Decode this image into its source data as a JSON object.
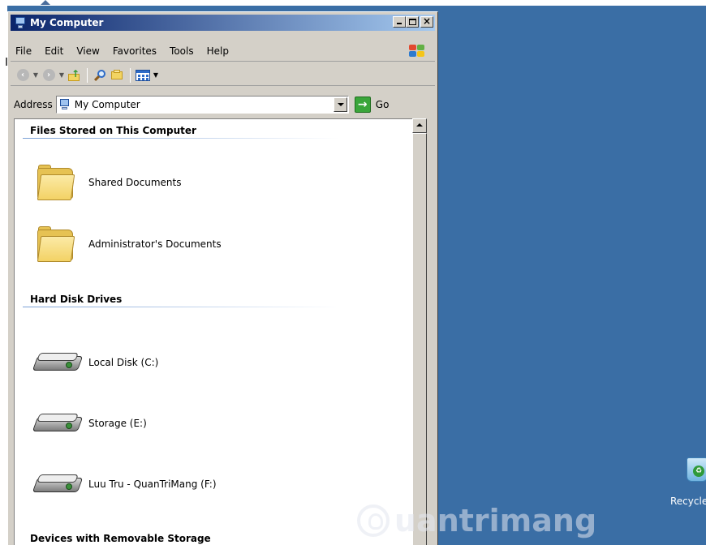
{
  "window": {
    "title": "My Computer",
    "buttons": {
      "minimize": "_",
      "maximize": "□",
      "close": "×"
    }
  },
  "menubar": {
    "items": [
      "File",
      "Edit",
      "View",
      "Favorites",
      "Tools",
      "Help"
    ]
  },
  "toolbar": {
    "icons": [
      "back-icon",
      "forward-icon",
      "up-folder-icon",
      "search-icon",
      "folders-icon",
      "views-icon"
    ]
  },
  "address": {
    "label": "Address",
    "value": "My Computer",
    "go_label": "Go"
  },
  "sections": [
    {
      "heading": "Files Stored on This Computer",
      "items": [
        {
          "label": "Shared Documents",
          "icon": "folder-icon"
        },
        {
          "label": "Administrator's Documents",
          "icon": "folder-icon"
        }
      ]
    },
    {
      "heading": "Hard Disk Drives",
      "items": [
        {
          "label": "Local Disk (C:)",
          "icon": "hard-drive-icon"
        },
        {
          "label": "Storage (E:)",
          "icon": "hard-drive-icon"
        },
        {
          "label": "Luu Tru - QuanTriMang (F:)",
          "icon": "hard-drive-icon"
        }
      ]
    },
    {
      "heading": "Devices with Removable Storage",
      "items": []
    }
  ],
  "desktop": {
    "recycle_label": "Recycle",
    "background_color": "#3a6ea5"
  },
  "watermark": {
    "text": "uantrimang"
  }
}
